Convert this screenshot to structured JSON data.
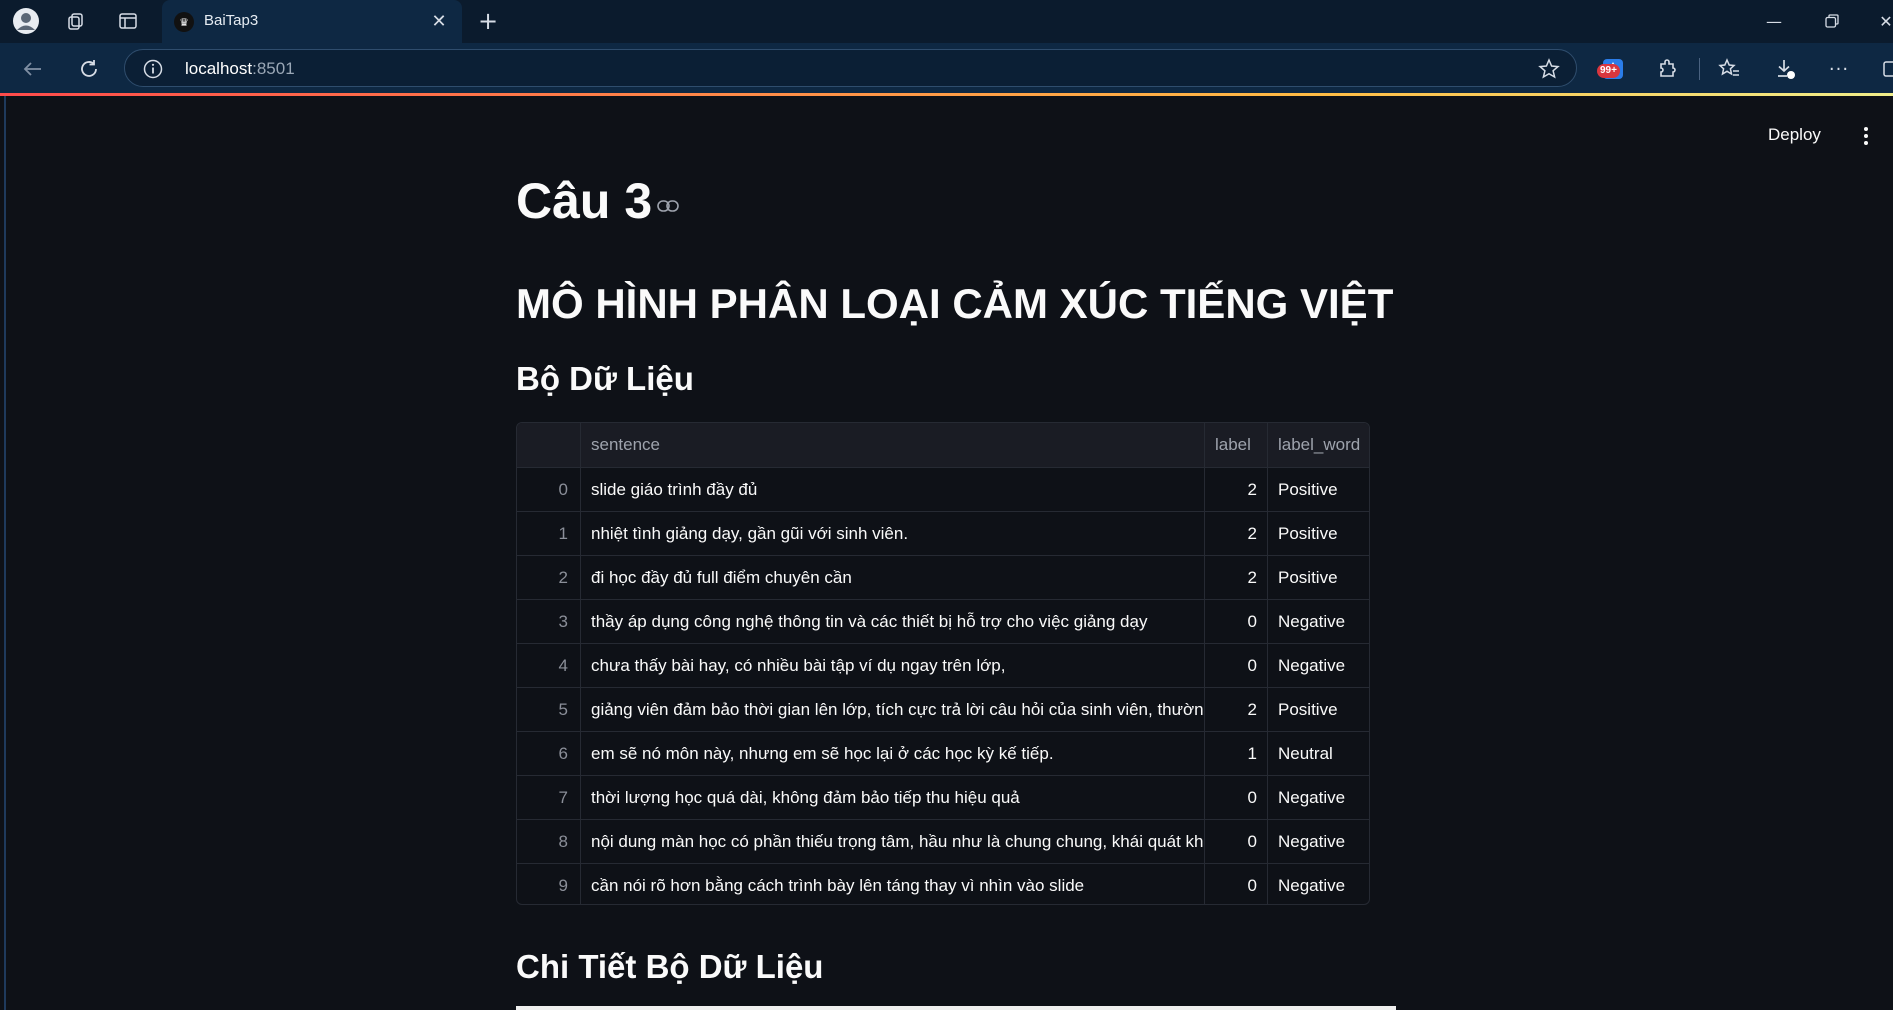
{
  "browser": {
    "tab_title": "BaiTap3",
    "url_host": "localhost",
    "url_port": ":8501",
    "extension_badge": "99+"
  },
  "app": {
    "deploy_label": "Deploy",
    "title": "Câu 3",
    "subtitle": "MÔ HÌNH PHÂN LOẠI CẢM XÚC TIẾNG VIỆT",
    "section_dataset": "Bộ Dữ Liệu",
    "section_details": "Chi Tiết Bộ Dữ Liệu"
  },
  "table": {
    "columns": [
      "",
      "sentence",
      "label",
      "label_word"
    ],
    "rows": [
      {
        "idx": "0",
        "sentence": "slide giáo trình đầy đủ",
        "label": "2",
        "label_word": "Positive"
      },
      {
        "idx": "1",
        "sentence": "nhiệt tình giảng dạy, gần gũi với sinh viên.",
        "label": "2",
        "label_word": "Positive"
      },
      {
        "idx": "2",
        "sentence": "đi học đầy đủ full điểm chuyên cần",
        "label": "2",
        "label_word": "Positive"
      },
      {
        "idx": "3",
        "sentence": "thầy áp dụng công nghệ thông tin và các thiết bị hỗ trợ cho việc giảng dạy",
        "label": "0",
        "label_word": "Negative"
      },
      {
        "idx": "4",
        "sentence": "chưa thấy bài hay, có nhiều bài tập ví dụ ngay trên lớp,",
        "label": "0",
        "label_word": "Negative"
      },
      {
        "idx": "5",
        "sentence": "giảng viên đảm bảo thời gian lên lớp, tích cực trả lời câu hỏi của sinh viên, thường xuy",
        "label": "2",
        "label_word": "Positive"
      },
      {
        "idx": "6",
        "sentence": "em sẽ nó môn này, nhưng em sẽ học lại ở các học kỳ kế tiếp.",
        "label": "1",
        "label_word": "Neutral"
      },
      {
        "idx": "7",
        "sentence": "thời lượng học quá dài, không đảm bảo tiếp thu hiệu quả",
        "label": "0",
        "label_word": "Negative"
      },
      {
        "idx": "8",
        "sentence": "nội dung màn học có phần thiếu trọng tâm, hầu như là chung chung, khái quát khiới",
        "label": "0",
        "label_word": "Negative"
      },
      {
        "idx": "9",
        "sentence": "cần nói rõ hơn bằng cách trình bày lên táng thay vì nhìn vào slide",
        "label": "0",
        "label_word": "Negative"
      }
    ]
  }
}
